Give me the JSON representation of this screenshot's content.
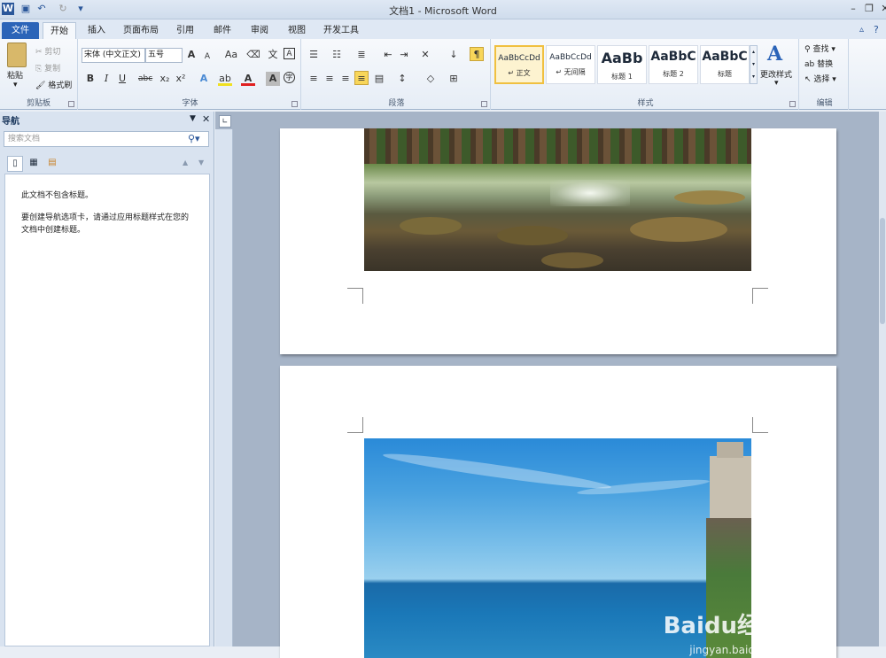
{
  "window": {
    "title": "文档1  -  Microsoft Word"
  },
  "tabs": [
    "文件",
    "开始",
    "插入",
    "页面布局",
    "引用",
    "邮件",
    "审阅",
    "视图",
    "开发工具"
  ],
  "clipboard": {
    "paste": "粘贴",
    "cut": "剪切",
    "copy": "复制",
    "format_painter": "格式刷",
    "label": "剪贴板"
  },
  "font": {
    "name": "宋体 (中文正文)",
    "size": "五号",
    "grow": "A",
    "shrink": "A",
    "case": "Aa",
    "label": "字体"
  },
  "paragraph": {
    "label": "段落"
  },
  "styles": {
    "label": "样式",
    "items": [
      {
        "preview": "AaBbCcDd",
        "name": "↵ 正文"
      },
      {
        "preview": "AaBbCcDd",
        "name": "↵ 无间隔"
      },
      {
        "preview": "AaBb",
        "name": "标题 1"
      },
      {
        "preview": "AaBbC",
        "name": "标题 2"
      },
      {
        "preview": "AaBbC",
        "name": "标题"
      }
    ],
    "change": "更改样式"
  },
  "editing": {
    "find": "查找",
    "replace": "替换",
    "select": "选择",
    "label": "编辑"
  },
  "nav": {
    "title": "导航",
    "search_placeholder": "搜索文档",
    "no_headings": "此文档不包含标题。",
    "hint": "要创建导航选项卡，请通过应用标题样式在您的文档中创建标题。"
  },
  "watermark": {
    "brand": "Baidu经验",
    "url": "jingyan.baidu.com"
  }
}
